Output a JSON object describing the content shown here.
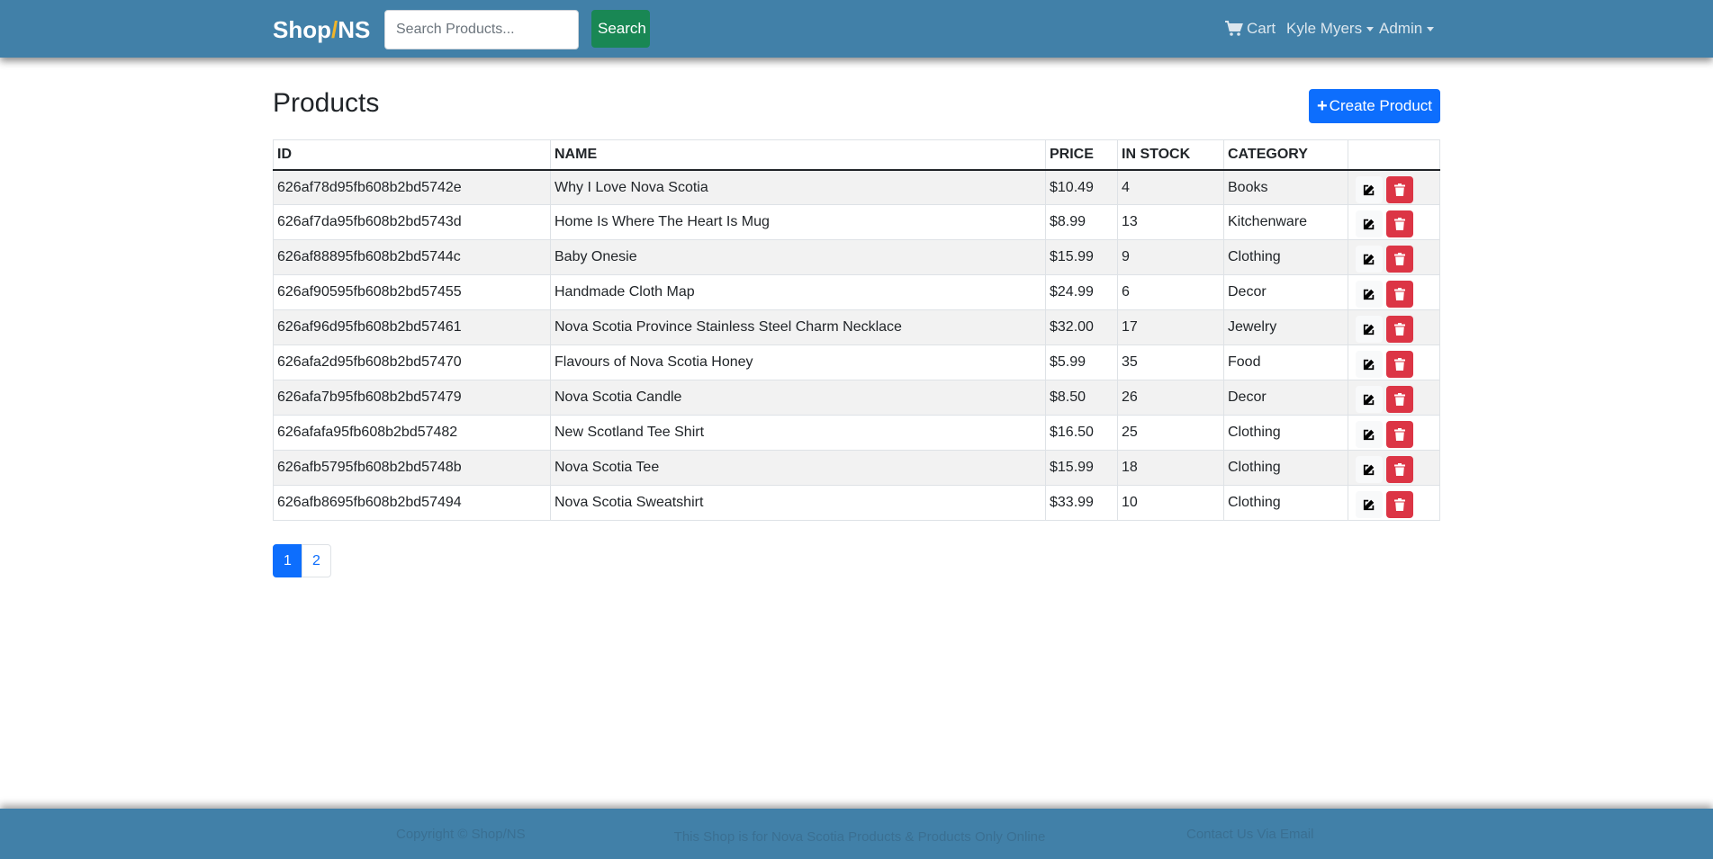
{
  "header": {
    "brand_prefix": "Shop",
    "brand_slash": "/",
    "brand_suffix": "NS",
    "search_placeholder": "Search Products...",
    "search_button": "Search",
    "cart_label": "Cart",
    "user_label": "Kyle Myers",
    "admin_label": "Admin"
  },
  "main": {
    "title": "Products",
    "create_button": "Create Product"
  },
  "table": {
    "columns": [
      "ID",
      "NAME",
      "PRICE",
      "IN STOCK",
      "CATEGORY"
    ],
    "rows": [
      {
        "id": "626af78d95fb608b2bd5742e",
        "name": "Why I Love Nova Scotia",
        "price": "$10.49",
        "stock": "4",
        "category": "Books"
      },
      {
        "id": "626af7da95fb608b2bd5743d",
        "name": "Home Is Where The Heart Is Mug",
        "price": "$8.99",
        "stock": "13",
        "category": "Kitchenware"
      },
      {
        "id": "626af88895fb608b2bd5744c",
        "name": "Baby Onesie",
        "price": "$15.99",
        "stock": "9",
        "category": "Clothing"
      },
      {
        "id": "626af90595fb608b2bd57455",
        "name": "Handmade Cloth Map",
        "price": "$24.99",
        "stock": "6",
        "category": "Decor"
      },
      {
        "id": "626af96d95fb608b2bd57461",
        "name": "Nova Scotia Province Stainless Steel Charm Necklace",
        "price": "$32.00",
        "stock": "17",
        "category": "Jewelry"
      },
      {
        "id": "626afa2d95fb608b2bd57470",
        "name": "Flavours of Nova Scotia Honey",
        "price": "$5.99",
        "stock": "35",
        "category": "Food"
      },
      {
        "id": "626afa7b95fb608b2bd57479",
        "name": "Nova Scotia Candle",
        "price": "$8.50",
        "stock": "26",
        "category": "Decor"
      },
      {
        "id": "626afafa95fb608b2bd57482",
        "name": "New Scotland Tee Shirt",
        "price": "$16.50",
        "stock": "25",
        "category": "Clothing"
      },
      {
        "id": "626afb5795fb608b2bd5748b",
        "name": "Nova Scotia Tee",
        "price": "$15.99",
        "stock": "18",
        "category": "Clothing"
      },
      {
        "id": "626afb8695fb608b2bd57494",
        "name": "Nova Scotia Sweatshirt",
        "price": "$33.99",
        "stock": "10",
        "category": "Clothing"
      }
    ]
  },
  "pagination": {
    "pages": [
      "1",
      "2"
    ],
    "active": "1"
  },
  "footer": {
    "left": "Copyright © Shop/NS",
    "middle": "This Shop is for Nova Scotia Products & Products Only Online",
    "right": "Contact Us Via Email"
  },
  "colors": {
    "navbar": "#4180a8",
    "primary": "#0d6efd",
    "success": "#198754",
    "danger": "#dc3545",
    "brand_slash": "#f0b429"
  },
  "icons": {
    "cart": "cart-icon",
    "edit": "edit-icon",
    "delete": "trash-icon",
    "create": "plus-icon"
  }
}
